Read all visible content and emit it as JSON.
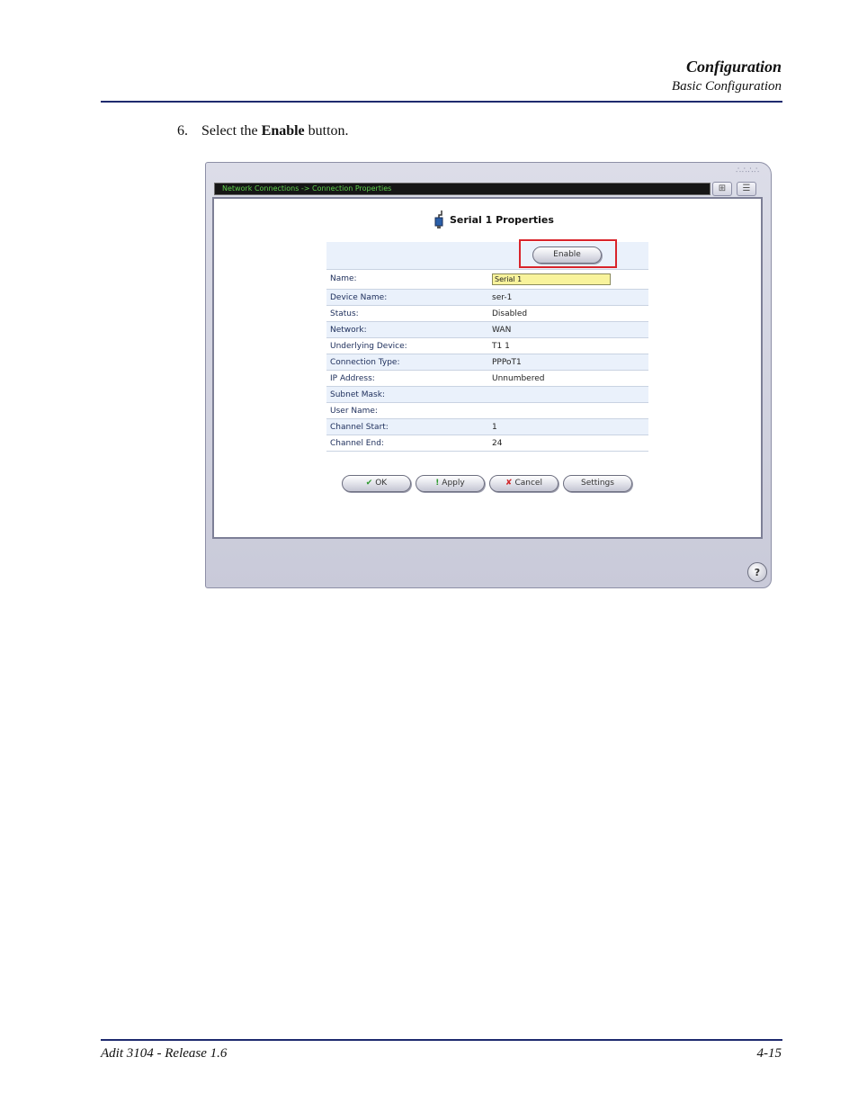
{
  "header": {
    "title": "Configuration",
    "subtitle": "Basic Configuration"
  },
  "step": {
    "number": "6.",
    "prefix": "Select the ",
    "bold": "Enable",
    "suffix": " button."
  },
  "window": {
    "breadcrumb": "Network Connections -> Connection Properties",
    "toolbar_icons": [
      "network-map-icon",
      "list-icon"
    ],
    "panel_title": "Serial 1 Properties",
    "enable_button": "Enable",
    "fields": [
      {
        "label": "Name:",
        "value": "Serial 1"
      },
      {
        "label": "Device Name:",
        "value": "ser-1"
      },
      {
        "label": "Status:",
        "value": "Disabled"
      },
      {
        "label": "Network:",
        "value": "WAN"
      },
      {
        "label": "Underlying Device:",
        "value": "T1 1"
      },
      {
        "label": "Connection Type:",
        "value": "PPPoT1"
      },
      {
        "label": "IP Address:",
        "value": "Unnumbered"
      },
      {
        "label": "Subnet Mask:",
        "value": ""
      },
      {
        "label": "User Name:",
        "value": ""
      },
      {
        "label": "Channel Start:",
        "value": "1"
      },
      {
        "label": "Channel End:",
        "value": "24"
      }
    ],
    "buttons": {
      "ok": "OK",
      "apply": "Apply",
      "cancel": "Cancel",
      "settings": "Settings"
    },
    "highlight_color": "#d9242b",
    "help": "?"
  },
  "footer": {
    "left": "Adit 3104 - Release 1.6",
    "right": "4-15"
  }
}
